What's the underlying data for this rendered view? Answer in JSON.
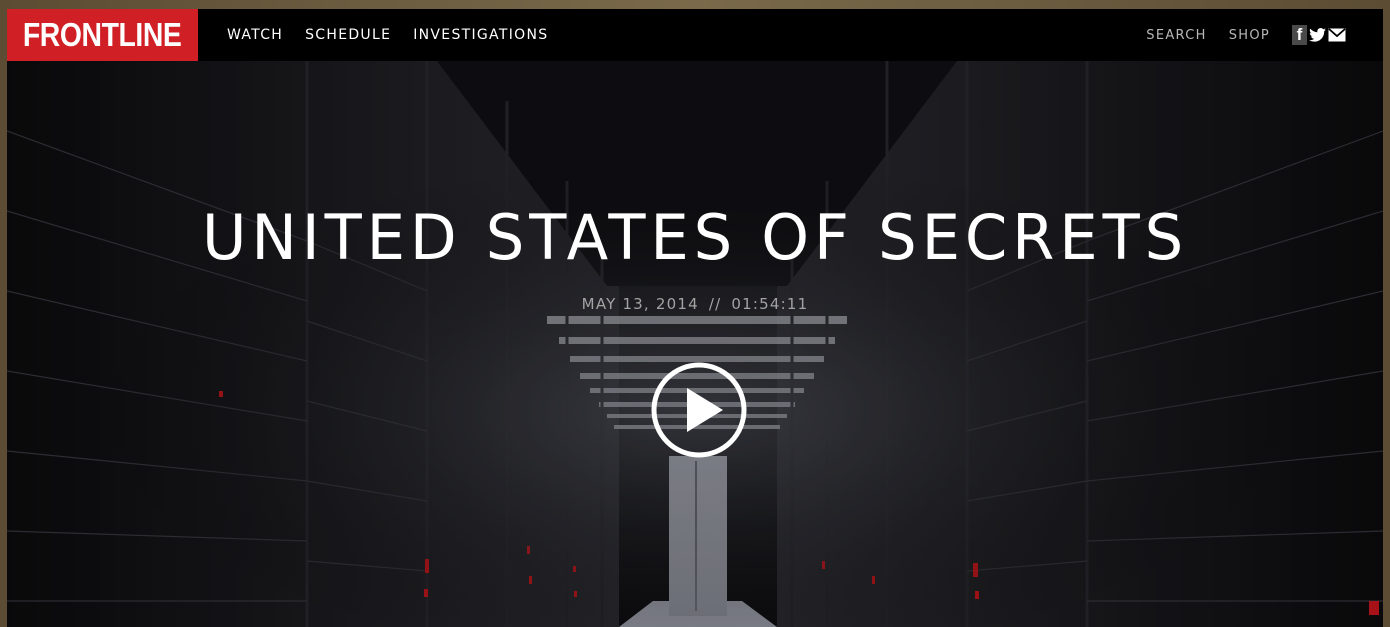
{
  "header": {
    "logo_text": "FRONTLINE",
    "nav": [
      "WATCH",
      "SCHEDULE",
      "INVESTIGATIONS"
    ],
    "utility": {
      "search": "SEARCH",
      "shop": "SHOP"
    },
    "social_icons": [
      "facebook-icon",
      "twitter-icon",
      "email-icon"
    ],
    "social_glyphs": {
      "facebook": "f",
      "twitter": "🐦",
      "email": "✉"
    }
  },
  "hero": {
    "title": "UNITED STATES OF SECRETS",
    "date": "MAY 13, 2014",
    "separator": "//",
    "duration": "01:54:11",
    "play_icon": "play-icon"
  },
  "colors": {
    "brand_red": "#d01f25",
    "bar_black": "#000000",
    "meta_gray": "#a3a3a3"
  }
}
